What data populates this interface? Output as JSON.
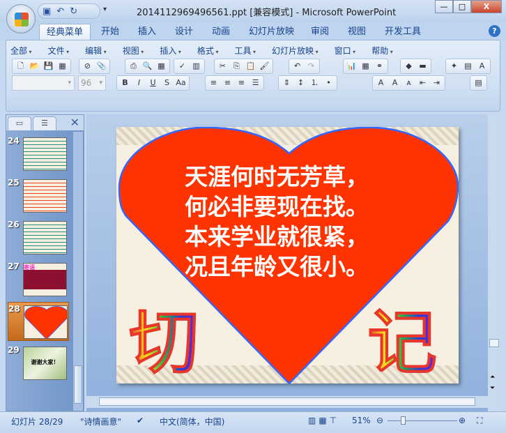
{
  "window": {
    "title": "2014112969496561.ppt [兼容模式] - Microsoft PowerPoint",
    "minimize": "—",
    "maximize": "□",
    "close": "X"
  },
  "ribbon_tabs": [
    "经典菜单",
    "开始",
    "插入",
    "设计",
    "动画",
    "幻灯片放映",
    "审阅",
    "视图",
    "开发工具"
  ],
  "help": "?",
  "classic_menus": [
    "全部",
    "文件",
    "编辑",
    "视图",
    "插入",
    "格式",
    "工具",
    "幻灯片放映",
    "窗口",
    "帮助"
  ],
  "font": {
    "name": "",
    "size": "96"
  },
  "format_buttons": {
    "bold": "B",
    "italic": "I",
    "underline": "U",
    "shadow": "S",
    "case": "Aa"
  },
  "slides": [
    {
      "num": "24"
    },
    {
      "num": "25"
    },
    {
      "num": "26"
    },
    {
      "num": "27",
      "title": "寄语"
    },
    {
      "num": "28",
      "selected": true
    },
    {
      "num": "29",
      "title": "谢谢大家！"
    }
  ],
  "slide": {
    "lines": [
      "天涯何时无芳草，",
      "何必非要现在找。",
      "本来学业就很紧，",
      "况且年龄又很小。"
    ],
    "left_char": "切",
    "right_char": "记",
    "heart_color": "#ff3300",
    "heart_outline": "#3366ff"
  },
  "status": {
    "slide": "幻灯片 28/29",
    "theme": "\"诗情画意\"",
    "language": "中文(简体，中国)",
    "zoom": "51%",
    "zoom_fraction": 0.51
  }
}
